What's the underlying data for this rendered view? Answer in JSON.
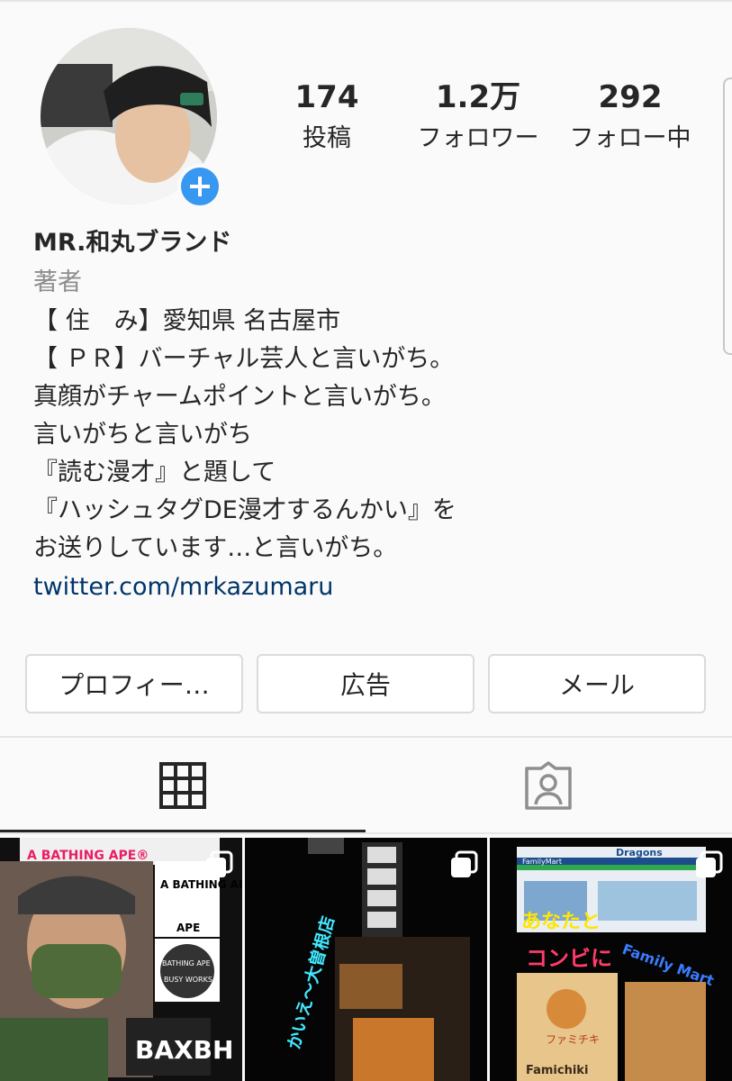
{
  "profile": {
    "name": "MR.和丸ブランド",
    "category": "著者",
    "bio_lines": [
      "【 住　み】愛知県 名古屋市",
      "【 ＰＲ】バーチャル芸人と言いがち。",
      "真顔がチャームポイントと言いがち。",
      "言いがちと言いがち",
      "『読む漫才』と題して",
      "『ハッシュタグDE漫才するんかい』を",
      "お送りしています…と言いがち。"
    ],
    "link": "twitter.com/mrkazumaru"
  },
  "stats": {
    "posts": {
      "value": "174",
      "label": "投稿"
    },
    "followers": {
      "value": "1.2万",
      "label": "フォロワー"
    },
    "following": {
      "value": "292",
      "label": "フォロー中"
    }
  },
  "buttons": {
    "profile": "プロフィー…",
    "ads": "広告",
    "mail": "メール"
  },
  "tabs": {
    "grid_icon": "grid-icon",
    "tagged_icon": "tagged-person-icon",
    "active": "grid"
  },
  "posts": [
    {
      "texts": [
        "A BATHING APE®",
        "A BATHING APE",
        "APE",
        "BAXBH",
        "BATHING APE",
        "BUSY WORKS"
      ],
      "multi": true
    },
    {
      "texts": [
        "かいえ〜大曽根店"
      ],
      "multi": true
    },
    {
      "texts": [
        "あなたと",
        "コンビに",
        "Family Mart",
        "FamilyMart",
        "Dragons",
        "ファミチキ",
        "Famichiki"
      ],
      "multi": true
    }
  ],
  "colors": {
    "accent": "#3897f0",
    "link": "#003569",
    "muted": "#8e8e8e",
    "text": "#262626"
  }
}
